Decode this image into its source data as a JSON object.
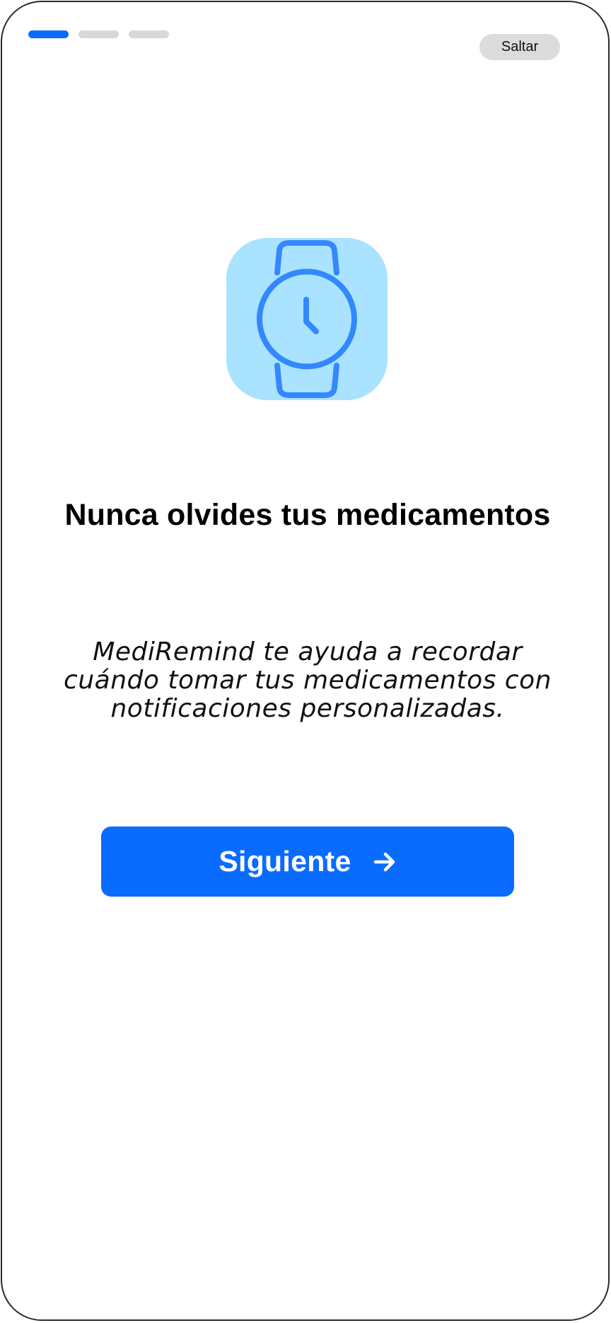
{
  "onboarding": {
    "progress": {
      "total_steps": 3,
      "current_step": 1
    },
    "skip_label": "Saltar",
    "hero_icon": "watch-icon",
    "title": "Nunca olvides tus medicamentos",
    "description": "MediRemind te ayuda a recordar cuándo tomar tus medicamentos con notificaciones personalizadas.",
    "next_label": "Siguiente",
    "next_icon": "arrow-right-icon"
  },
  "colors": {
    "primary": "#0a6cff",
    "icon_background": "#aae3ff",
    "icon_stroke": "#3388ff",
    "inactive_step": "#d8d8d8",
    "skip_background": "#dcdcdc"
  }
}
